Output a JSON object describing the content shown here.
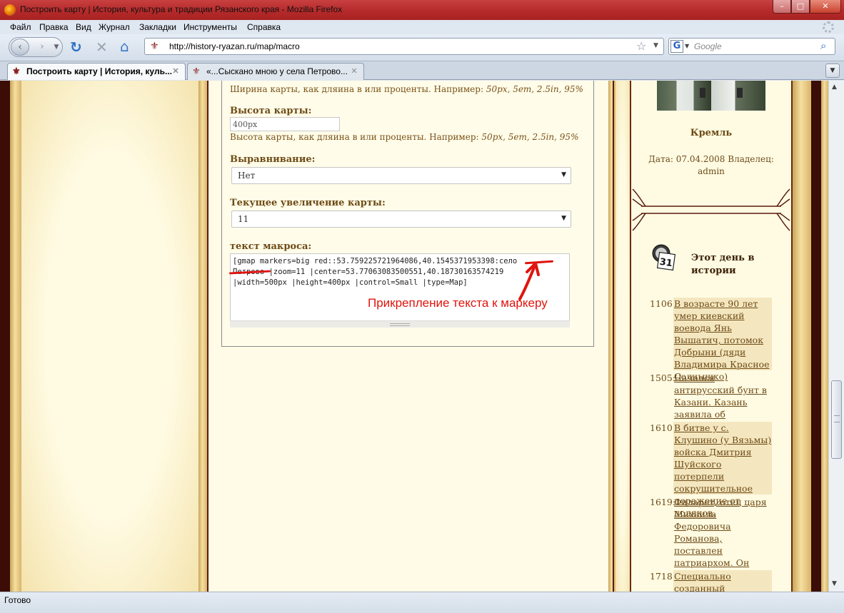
{
  "window": {
    "title": "Построить карту | История, культура и традиции Рязанского края - Mozilla Firefox",
    "minimize": "–",
    "maximize": "□",
    "close": "✕"
  },
  "menu": [
    "Файл",
    "Правка",
    "Вид",
    "Журнал",
    "Закладки",
    "Инструменты",
    "Справка"
  ],
  "nav": {
    "url": "http://history-ryazan.ru/map/macro",
    "search_placeholder": "Google",
    "search_engine_icon": "G"
  },
  "tabs": [
    {
      "label": "Построить карту | История, куль...",
      "active": true
    },
    {
      "label": "«...Сыскано мною у села Петрово...",
      "active": false
    }
  ],
  "form": {
    "width_desc": "Ширина карты, как дляина в или проценты. Например:",
    "width_examples": "50px, 5em, 2.5in, 95%",
    "height_label": "Высота карты:",
    "height_value": "400px",
    "height_desc": "Высота карты, как дляина в или проценты. Например:",
    "height_examples": "50px, 5em, 2.5in, 95%",
    "align_label": "Выравнивание:",
    "align_value": "Нет",
    "zoom_label": "Текущее увеличение карты:",
    "zoom_value": "11",
    "macro_label": "текст макроса:",
    "macro_line1": "[gmap markers=big red::53.759225721964086,40.1545371953398:село",
    "macro_line2": "Петрово |zoom=11 |center=53.77063083500551,40.18730163574219",
    "macro_line3": "|width=500px |height=400px |control=Small |type=Map]"
  },
  "annotation": {
    "text": "Прикрепление текста к маркеру",
    "color": "#e0140e"
  },
  "sidebar": {
    "photo_caption": "Кремль",
    "photo_meta": "Дата: 07.04.2008 Владелец: admin",
    "history_icon_number": "31",
    "history_title": "Этот день в истории",
    "events": [
      {
        "year": "1106:",
        "text": "В возрасте 90 лет умер киевский воевода Янь Вышатич, потомок Добрыни (дяди Владимира Красное Солнышко)"
      },
      {
        "year": "1505:",
        "text": "Начался антирусский бунт в Казани. Казань заявила об отделении от Москвы."
      },
      {
        "year": "1610:",
        "text": "В битве у с. Клушино (у Вязьмы) войска Дмитрия Шуйского потерпели сокрушительное поражение от поляков."
      },
      {
        "year": "1619:",
        "text": "Филарет, отец царя Михаила Федоровича Романова, поставлен патриархом. Он стал фактическим правителем России"
      },
      {
        "year": "1718:",
        "text": "Специально созданный Верховный суд"
      }
    ]
  },
  "status": "Готово"
}
